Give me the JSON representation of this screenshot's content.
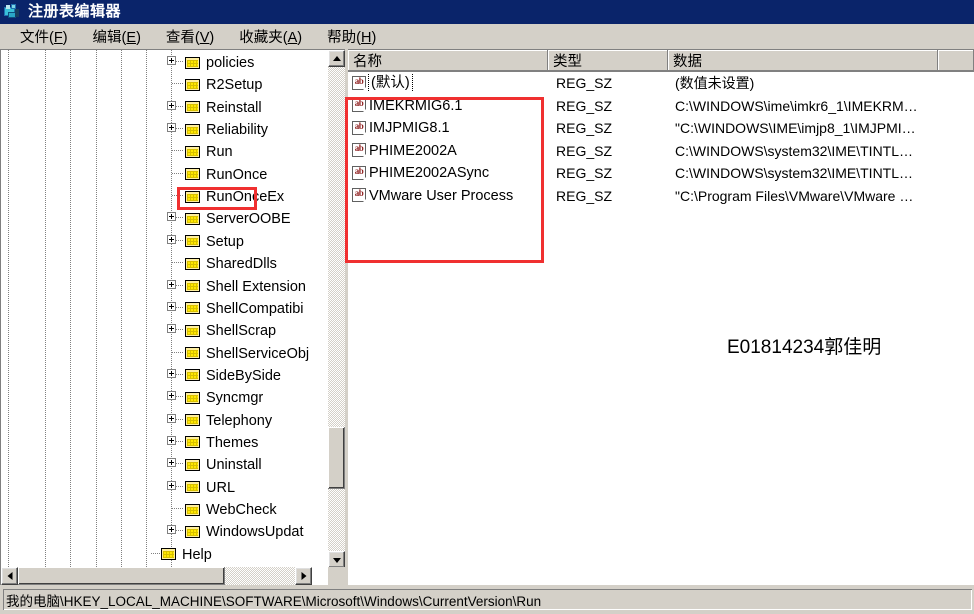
{
  "window": {
    "title": "注册表编辑器",
    "icon": "regedit-icon"
  },
  "menubar": {
    "items": [
      {
        "label": "文件(F)",
        "text": "文件(",
        "accel": "F",
        "tail": ")"
      },
      {
        "label": "编辑(E)",
        "text": "编辑(",
        "accel": "E",
        "tail": ")"
      },
      {
        "label": "查看(V)",
        "text": "查看(",
        "accel": "V",
        "tail": ")"
      },
      {
        "label": "收藏夹(A)",
        "text": "收藏夹(",
        "accel": "A",
        "tail": ")"
      },
      {
        "label": "帮助(H)",
        "text": "帮助(",
        "accel": "H",
        "tail": ")"
      }
    ]
  },
  "tree": {
    "items": [
      {
        "label": "policies",
        "expandable": true,
        "selected": false
      },
      {
        "label": "R2Setup",
        "expandable": false,
        "selected": false
      },
      {
        "label": "Reinstall",
        "expandable": true,
        "selected": false
      },
      {
        "label": "Reliability",
        "expandable": true,
        "selected": false
      },
      {
        "label": "Run",
        "expandable": false,
        "selected": true
      },
      {
        "label": "RunOnce",
        "expandable": false,
        "selected": false
      },
      {
        "label": "RunOnceEx",
        "expandable": false,
        "selected": false
      },
      {
        "label": "ServerOOBE",
        "expandable": true,
        "selected": false
      },
      {
        "label": "Setup",
        "expandable": true,
        "selected": false
      },
      {
        "label": "SharedDlls",
        "expandable": false,
        "selected": false
      },
      {
        "label": "Shell Extension",
        "expandable": true,
        "selected": false
      },
      {
        "label": "ShellCompatibi",
        "expandable": true,
        "selected": false
      },
      {
        "label": "ShellScrap",
        "expandable": true,
        "selected": false
      },
      {
        "label": "ShellServiceObj",
        "expandable": false,
        "selected": false
      },
      {
        "label": "SideBySide",
        "expandable": true,
        "selected": false
      },
      {
        "label": "Syncmgr",
        "expandable": true,
        "selected": false
      },
      {
        "label": "Telephony",
        "expandable": true,
        "selected": false
      },
      {
        "label": "Themes",
        "expandable": true,
        "selected": false
      },
      {
        "label": "Uninstall",
        "expandable": true,
        "selected": false
      },
      {
        "label": "URL",
        "expandable": true,
        "selected": false
      },
      {
        "label": "WebCheck",
        "expandable": false,
        "selected": false
      },
      {
        "label": "WindowsUpdat",
        "expandable": true,
        "selected": false
      }
    ],
    "parent_item": {
      "label": "Help",
      "expandable": false
    }
  },
  "list": {
    "columns": [
      "名称",
      "类型",
      "数据"
    ],
    "rows": [
      {
        "name": "(默认)",
        "type": "REG_SZ",
        "data": "(数值未设置)",
        "selected": true
      },
      {
        "name": "IMEKRMIG6.1",
        "type": "REG_SZ",
        "data": "C:\\WINDOWS\\ime\\imkr6_1\\IMEKRM…",
        "selected": false
      },
      {
        "name": "IMJPMIG8.1",
        "type": "REG_SZ",
        "data": "\"C:\\WINDOWS\\IME\\imjp8_1\\IMJPMI…",
        "selected": false
      },
      {
        "name": "PHIME2002A",
        "type": "REG_SZ",
        "data": "C:\\WINDOWS\\system32\\IME\\TINTL…",
        "selected": false
      },
      {
        "name": "PHIME2002ASync",
        "type": "REG_SZ",
        "data": "C:\\WINDOWS\\system32\\IME\\TINTL…",
        "selected": false
      },
      {
        "name": "VMware User Process",
        "type": "REG_SZ",
        "data": "\"C:\\Program Files\\VMware\\VMware …",
        "selected": false
      }
    ]
  },
  "annotations": {
    "highlight_color": "#f03030",
    "watermark": "E01814234郭佳明"
  },
  "statusbar": {
    "path": "我的电脑\\HKEY_LOCAL_MACHINE\\SOFTWARE\\Microsoft\\Windows\\CurrentVersion\\Run"
  }
}
